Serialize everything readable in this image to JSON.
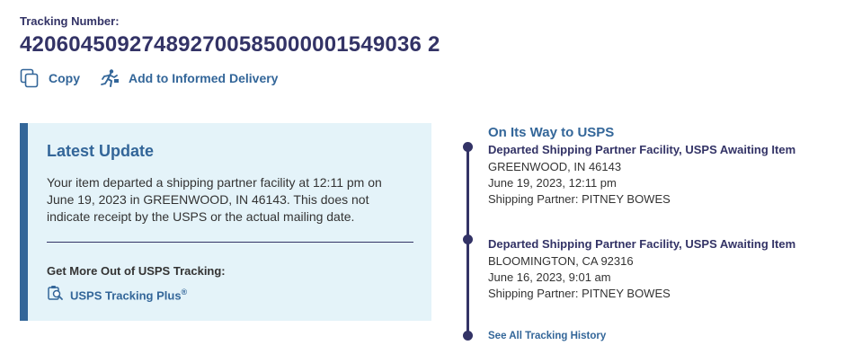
{
  "header": {
    "label": "Tracking Number:",
    "number": "420604509274892700585000001549036 2"
  },
  "actions": {
    "copy": {
      "label": "Copy",
      "icon": "copy-icon"
    },
    "informed": {
      "label": "Add to Informed Delivery",
      "icon": "running-person-icon"
    }
  },
  "latest_update": {
    "title": "Latest Update",
    "message": "Your item departed a shipping partner facility at 12:11 pm on June 19, 2023 in GREENWOOD, IN 46143. This does not indicate receipt by the USPS or the actual mailing date.",
    "more_heading": "Get More Out of USPS Tracking:",
    "plus_label": "USPS Tracking Plus",
    "plus_mark": "®"
  },
  "timeline": {
    "status": "On Its Way to USPS",
    "events": [
      {
        "title": "Departed Shipping Partner Facility, USPS Awaiting Item",
        "location": "GREENWOOD, IN 46143",
        "datetime": "June 19, 2023, 12:11 pm",
        "partner": "Shipping Partner: PITNEY BOWES"
      },
      {
        "title": "Departed Shipping Partner Facility, USPS Awaiting Item",
        "location": "BLOOMINGTON, CA 92316",
        "datetime": "June 16, 2023, 9:01 am",
        "partner": "Shipping Partner: PITNEY BOWES"
      }
    ],
    "see_all": "See All Tracking History"
  },
  "colors": {
    "navy": "#333366",
    "link_blue": "#336699",
    "card_bg": "#e4f3f9"
  }
}
